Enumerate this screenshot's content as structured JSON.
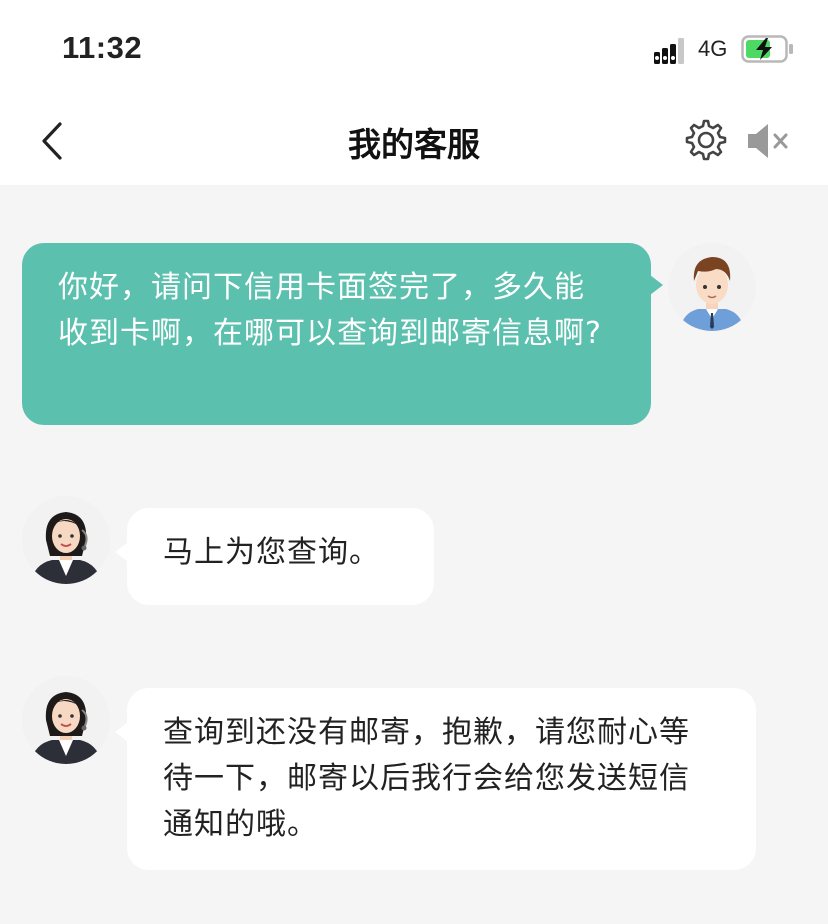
{
  "status_bar": {
    "time": "11:32",
    "network": "4G",
    "icons": [
      "signal-icon",
      "battery-charging-icon"
    ]
  },
  "nav": {
    "title": "我的客服",
    "icons": [
      "back-chevron-icon",
      "settings-gear-icon",
      "speaker-muted-icon"
    ]
  },
  "colors": {
    "user_bubble": "#5bc0ae",
    "agent_bubble": "#ffffff",
    "chat_background": "#f5f5f5",
    "battery_fill": "#4cd964"
  },
  "messages": [
    {
      "sender": "user",
      "avatar": "male-user-avatar",
      "text": "你好，请问下信用卡面签完了，多久能收到卡啊，在哪可以查询到邮寄信息啊?"
    },
    {
      "sender": "agent",
      "avatar": "female-agent-avatar",
      "text": "马上为您查询。"
    },
    {
      "sender": "agent",
      "avatar": "female-agent-avatar",
      "text": "查询到还没有邮寄，抱歉，请您耐心等待一下，邮寄以后我行会给您发送短信通知的哦。"
    }
  ]
}
